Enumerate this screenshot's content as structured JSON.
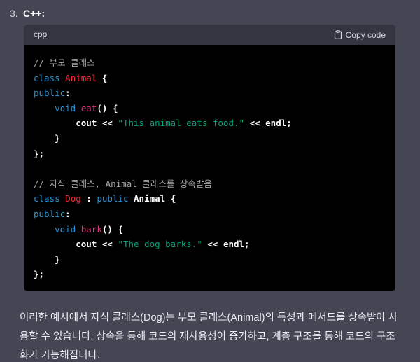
{
  "list_item": {
    "number": "3.",
    "title": "C++:"
  },
  "code_block": {
    "language": "cpp",
    "copy_label": "Copy code",
    "copy_icon": "clipboard-icon",
    "colors": {
      "background": "#000000",
      "header": "#343541",
      "comment": "#a8a8a8",
      "keyword": "#2e95d3",
      "class_name": "#f22c3d",
      "function_name": "#df3079",
      "string": "#00a67d"
    },
    "lines": [
      [
        {
          "t": "// 부모 클래스",
          "k": "comment"
        }
      ],
      [
        {
          "t": "class",
          "k": "keyword"
        },
        {
          "t": " ",
          "k": "plain"
        },
        {
          "t": "Animal",
          "k": "class"
        },
        {
          "t": " {",
          "k": "punct"
        }
      ],
      [
        {
          "t": "public",
          "k": "keyword"
        },
        {
          "t": ":",
          "k": "punct"
        }
      ],
      [
        {
          "t": "    ",
          "k": "plain"
        },
        {
          "t": "void",
          "k": "keyword"
        },
        {
          "t": " ",
          "k": "plain"
        },
        {
          "t": "eat",
          "k": "func"
        },
        {
          "t": "() {",
          "k": "punct"
        }
      ],
      [
        {
          "t": "        cout << ",
          "k": "plain"
        },
        {
          "t": "\"This animal eats food.\"",
          "k": "string"
        },
        {
          "t": " << endl;",
          "k": "plain"
        }
      ],
      [
        {
          "t": "    }",
          "k": "punct"
        }
      ],
      [
        {
          "t": "};",
          "k": "punct"
        }
      ],
      [],
      [
        {
          "t": "// 자식 클래스, Animal 클래스를 상속받음",
          "k": "comment"
        }
      ],
      [
        {
          "t": "class",
          "k": "keyword"
        },
        {
          "t": " ",
          "k": "plain"
        },
        {
          "t": "Dog",
          "k": "class"
        },
        {
          "t": " : ",
          "k": "punct"
        },
        {
          "t": "public",
          "k": "keyword"
        },
        {
          "t": " Animal {",
          "k": "plain"
        }
      ],
      [
        {
          "t": "public",
          "k": "keyword"
        },
        {
          "t": ":",
          "k": "punct"
        }
      ],
      [
        {
          "t": "    ",
          "k": "plain"
        },
        {
          "t": "void",
          "k": "keyword"
        },
        {
          "t": " ",
          "k": "plain"
        },
        {
          "t": "bark",
          "k": "func"
        },
        {
          "t": "() {",
          "k": "punct"
        }
      ],
      [
        {
          "t": "        cout << ",
          "k": "plain"
        },
        {
          "t": "\"The dog barks.\"",
          "k": "string"
        },
        {
          "t": " << endl;",
          "k": "plain"
        }
      ],
      [
        {
          "t": "    }",
          "k": "punct"
        }
      ],
      [
        {
          "t": "};",
          "k": "punct"
        }
      ]
    ]
  },
  "paragraph": {
    "text": "이러한 예시에서 자식 클래스(Dog)는 부모 클래스(Animal)의 특성과 메서드를 상속받아 사용할 수 있습니다. 상속을 통해 코드의 재사용성이 증가하고, 계층 구조를 통해 코드의 구조화가 가능해집니다."
  }
}
